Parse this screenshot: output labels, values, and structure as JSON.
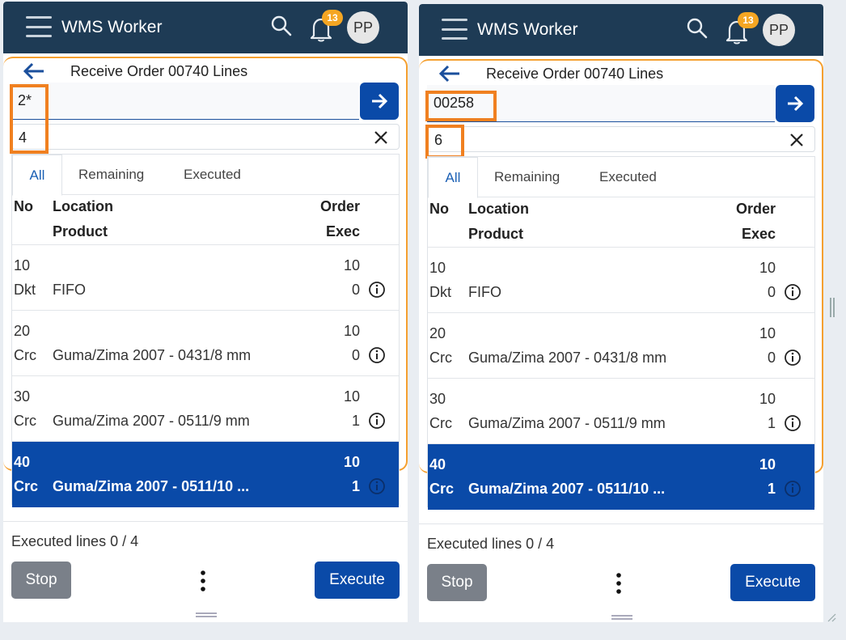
{
  "colors": {
    "header": "#1e3b55",
    "accent": "#0a4aa8",
    "badge": "#f5a623",
    "highlight": "#f08020"
  },
  "panels": [
    {
      "app_title": "WMS Worker",
      "notification_count": "13",
      "avatar": "PP",
      "page_title": "Receive Order 00740 Lines",
      "scan_value": "2*",
      "qty_value": "4",
      "tabs": [
        "All",
        "Remaining",
        "Executed"
      ],
      "columns": {
        "no": "No",
        "location": "Location",
        "product": "Product",
        "order": "Order",
        "exec": "Exec"
      },
      "rows": [
        {
          "no": "10",
          "location": "Dkt",
          "product": "FIFO",
          "order": "10",
          "exec": "0"
        },
        {
          "no": "20",
          "location": "Crc",
          "product": "Guma/Zima 2007 - 0431/8 mm",
          "order": "10",
          "exec": "0"
        },
        {
          "no": "30",
          "location": "Crc",
          "product": "Guma/Zima 2007 - 0511/9 mm",
          "order": "10",
          "exec": "1"
        },
        {
          "no": "40",
          "location": "Crc",
          "product": "Guma/Zima 2007 - 0511/10 ...",
          "order": "10",
          "exec": "1"
        }
      ],
      "executed_lines": "Executed lines 0 / 4",
      "stop_label": "Stop",
      "execute_label": "Execute"
    },
    {
      "app_title": "WMS Worker",
      "notification_count": "13",
      "avatar": "PP",
      "page_title": "Receive Order 00740 Lines",
      "scan_value": "00258",
      "qty_value": "6",
      "tabs": [
        "All",
        "Remaining",
        "Executed"
      ],
      "columns": {
        "no": "No",
        "location": "Location",
        "product": "Product",
        "order": "Order",
        "exec": "Exec"
      },
      "rows": [
        {
          "no": "10",
          "location": "Dkt",
          "product": "FIFO",
          "order": "10",
          "exec": "0"
        },
        {
          "no": "20",
          "location": "Crc",
          "product": "Guma/Zima 2007 - 0431/8 mm",
          "order": "10",
          "exec": "0"
        },
        {
          "no": "30",
          "location": "Crc",
          "product": "Guma/Zima 2007 - 0511/9 mm",
          "order": "10",
          "exec": "1"
        },
        {
          "no": "40",
          "location": "Crc",
          "product": "Guma/Zima 2007 - 0511/10 ...",
          "order": "10",
          "exec": "1"
        }
      ],
      "executed_lines": "Executed lines 0 / 4",
      "stop_label": "Stop",
      "execute_label": "Execute"
    }
  ]
}
